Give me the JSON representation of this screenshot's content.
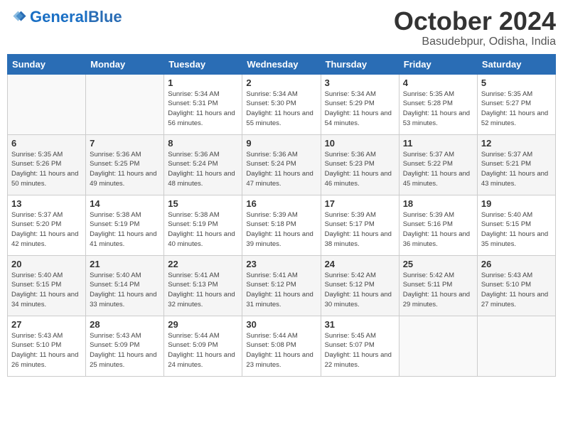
{
  "logo": {
    "text_general": "General",
    "text_blue": "Blue"
  },
  "title": "October 2024",
  "subtitle": "Basudebpur, Odisha, India",
  "days_of_week": [
    "Sunday",
    "Monday",
    "Tuesday",
    "Wednesday",
    "Thursday",
    "Friday",
    "Saturday"
  ],
  "weeks": [
    [
      {
        "day": null
      },
      {
        "day": null
      },
      {
        "day": "1",
        "sunrise": "Sunrise: 5:34 AM",
        "sunset": "Sunset: 5:31 PM",
        "daylight": "Daylight: 11 hours and 56 minutes."
      },
      {
        "day": "2",
        "sunrise": "Sunrise: 5:34 AM",
        "sunset": "Sunset: 5:30 PM",
        "daylight": "Daylight: 11 hours and 55 minutes."
      },
      {
        "day": "3",
        "sunrise": "Sunrise: 5:34 AM",
        "sunset": "Sunset: 5:29 PM",
        "daylight": "Daylight: 11 hours and 54 minutes."
      },
      {
        "day": "4",
        "sunrise": "Sunrise: 5:35 AM",
        "sunset": "Sunset: 5:28 PM",
        "daylight": "Daylight: 11 hours and 53 minutes."
      },
      {
        "day": "5",
        "sunrise": "Sunrise: 5:35 AM",
        "sunset": "Sunset: 5:27 PM",
        "daylight": "Daylight: 11 hours and 52 minutes."
      }
    ],
    [
      {
        "day": "6",
        "sunrise": "Sunrise: 5:35 AM",
        "sunset": "Sunset: 5:26 PM",
        "daylight": "Daylight: 11 hours and 50 minutes."
      },
      {
        "day": "7",
        "sunrise": "Sunrise: 5:36 AM",
        "sunset": "Sunset: 5:25 PM",
        "daylight": "Daylight: 11 hours and 49 minutes."
      },
      {
        "day": "8",
        "sunrise": "Sunrise: 5:36 AM",
        "sunset": "Sunset: 5:24 PM",
        "daylight": "Daylight: 11 hours and 48 minutes."
      },
      {
        "day": "9",
        "sunrise": "Sunrise: 5:36 AM",
        "sunset": "Sunset: 5:24 PM",
        "daylight": "Daylight: 11 hours and 47 minutes."
      },
      {
        "day": "10",
        "sunrise": "Sunrise: 5:36 AM",
        "sunset": "Sunset: 5:23 PM",
        "daylight": "Daylight: 11 hours and 46 minutes."
      },
      {
        "day": "11",
        "sunrise": "Sunrise: 5:37 AM",
        "sunset": "Sunset: 5:22 PM",
        "daylight": "Daylight: 11 hours and 45 minutes."
      },
      {
        "day": "12",
        "sunrise": "Sunrise: 5:37 AM",
        "sunset": "Sunset: 5:21 PM",
        "daylight": "Daylight: 11 hours and 43 minutes."
      }
    ],
    [
      {
        "day": "13",
        "sunrise": "Sunrise: 5:37 AM",
        "sunset": "Sunset: 5:20 PM",
        "daylight": "Daylight: 11 hours and 42 minutes."
      },
      {
        "day": "14",
        "sunrise": "Sunrise: 5:38 AM",
        "sunset": "Sunset: 5:19 PM",
        "daylight": "Daylight: 11 hours and 41 minutes."
      },
      {
        "day": "15",
        "sunrise": "Sunrise: 5:38 AM",
        "sunset": "Sunset: 5:19 PM",
        "daylight": "Daylight: 11 hours and 40 minutes."
      },
      {
        "day": "16",
        "sunrise": "Sunrise: 5:39 AM",
        "sunset": "Sunset: 5:18 PM",
        "daylight": "Daylight: 11 hours and 39 minutes."
      },
      {
        "day": "17",
        "sunrise": "Sunrise: 5:39 AM",
        "sunset": "Sunset: 5:17 PM",
        "daylight": "Daylight: 11 hours and 38 minutes."
      },
      {
        "day": "18",
        "sunrise": "Sunrise: 5:39 AM",
        "sunset": "Sunset: 5:16 PM",
        "daylight": "Daylight: 11 hours and 36 minutes."
      },
      {
        "day": "19",
        "sunrise": "Sunrise: 5:40 AM",
        "sunset": "Sunset: 5:15 PM",
        "daylight": "Daylight: 11 hours and 35 minutes."
      }
    ],
    [
      {
        "day": "20",
        "sunrise": "Sunrise: 5:40 AM",
        "sunset": "Sunset: 5:15 PM",
        "daylight": "Daylight: 11 hours and 34 minutes."
      },
      {
        "day": "21",
        "sunrise": "Sunrise: 5:40 AM",
        "sunset": "Sunset: 5:14 PM",
        "daylight": "Daylight: 11 hours and 33 minutes."
      },
      {
        "day": "22",
        "sunrise": "Sunrise: 5:41 AM",
        "sunset": "Sunset: 5:13 PM",
        "daylight": "Daylight: 11 hours and 32 minutes."
      },
      {
        "day": "23",
        "sunrise": "Sunrise: 5:41 AM",
        "sunset": "Sunset: 5:12 PM",
        "daylight": "Daylight: 11 hours and 31 minutes."
      },
      {
        "day": "24",
        "sunrise": "Sunrise: 5:42 AM",
        "sunset": "Sunset: 5:12 PM",
        "daylight": "Daylight: 11 hours and 30 minutes."
      },
      {
        "day": "25",
        "sunrise": "Sunrise: 5:42 AM",
        "sunset": "Sunset: 5:11 PM",
        "daylight": "Daylight: 11 hours and 29 minutes."
      },
      {
        "day": "26",
        "sunrise": "Sunrise: 5:43 AM",
        "sunset": "Sunset: 5:10 PM",
        "daylight": "Daylight: 11 hours and 27 minutes."
      }
    ],
    [
      {
        "day": "27",
        "sunrise": "Sunrise: 5:43 AM",
        "sunset": "Sunset: 5:10 PM",
        "daylight": "Daylight: 11 hours and 26 minutes."
      },
      {
        "day": "28",
        "sunrise": "Sunrise: 5:43 AM",
        "sunset": "Sunset: 5:09 PM",
        "daylight": "Daylight: 11 hours and 25 minutes."
      },
      {
        "day": "29",
        "sunrise": "Sunrise: 5:44 AM",
        "sunset": "Sunset: 5:09 PM",
        "daylight": "Daylight: 11 hours and 24 minutes."
      },
      {
        "day": "30",
        "sunrise": "Sunrise: 5:44 AM",
        "sunset": "Sunset: 5:08 PM",
        "daylight": "Daylight: 11 hours and 23 minutes."
      },
      {
        "day": "31",
        "sunrise": "Sunrise: 5:45 AM",
        "sunset": "Sunset: 5:07 PM",
        "daylight": "Daylight: 11 hours and 22 minutes."
      },
      {
        "day": null
      },
      {
        "day": null
      }
    ]
  ]
}
